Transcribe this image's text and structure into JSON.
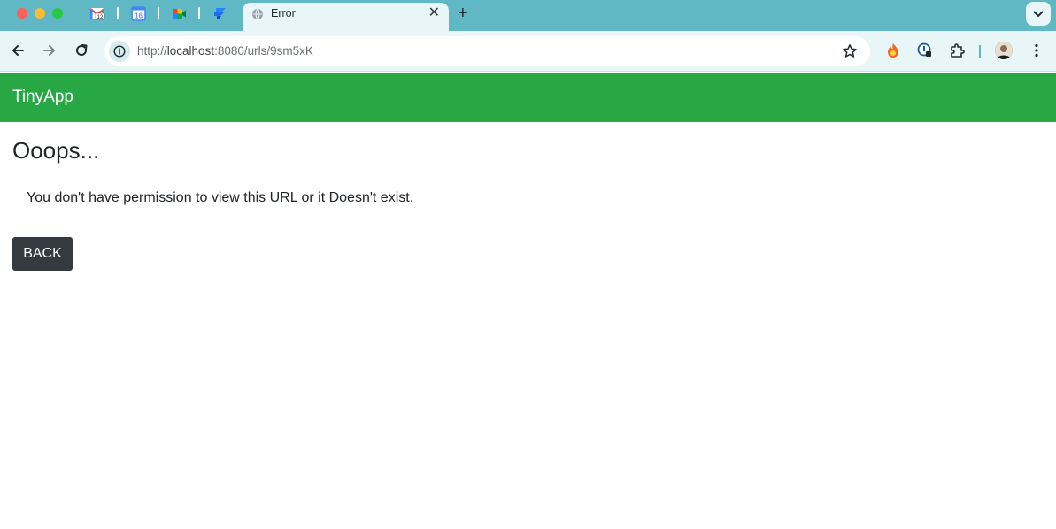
{
  "browser": {
    "active_tab": {
      "title": "Error",
      "close_glyph": "✕"
    },
    "pinned_tabs": [
      {
        "icon": "gmail-icon",
        "badge": "12"
      },
      {
        "icon": "google-calendar-icon",
        "badge": "16"
      },
      {
        "icon": "google-meet-icon"
      },
      {
        "icon": "jira-icon"
      }
    ],
    "new_tab_glyph": "+",
    "address": {
      "prefix": "http://",
      "host": "localhost",
      "rest": ":8080/urls/9sm5xK"
    },
    "colors": {
      "tab_strip": "#5fb8c4",
      "toolbar": "#e8f6f8"
    }
  },
  "navbar": {
    "brand": "TinyApp",
    "color": "#28a745"
  },
  "main": {
    "heading": "Ooops...",
    "message": "You don't have permission to view this URL or it Doesn't exist.",
    "back_label": "BACK",
    "button_color": "#343a40"
  }
}
